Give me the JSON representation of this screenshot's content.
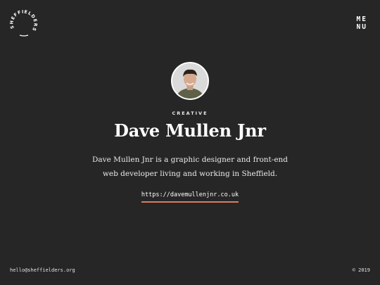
{
  "header": {
    "logo_text": "SHEFFIELDERS",
    "menu_line1": "ME",
    "menu_line2": "NU"
  },
  "profile": {
    "category": "CREATIVE",
    "name": "Dave Mullen Jnr",
    "bio": "Dave Mullen Jnr is a graphic designer and front-end web developer living and working in Sheffield.",
    "website": "https://davemullenjnr.co.uk"
  },
  "footer": {
    "email": "hello@sheffielders.org",
    "copyright": "© 2019"
  },
  "colors": {
    "background": "#262626",
    "text": "#ffffff",
    "link_underline": "#d77c5e"
  }
}
